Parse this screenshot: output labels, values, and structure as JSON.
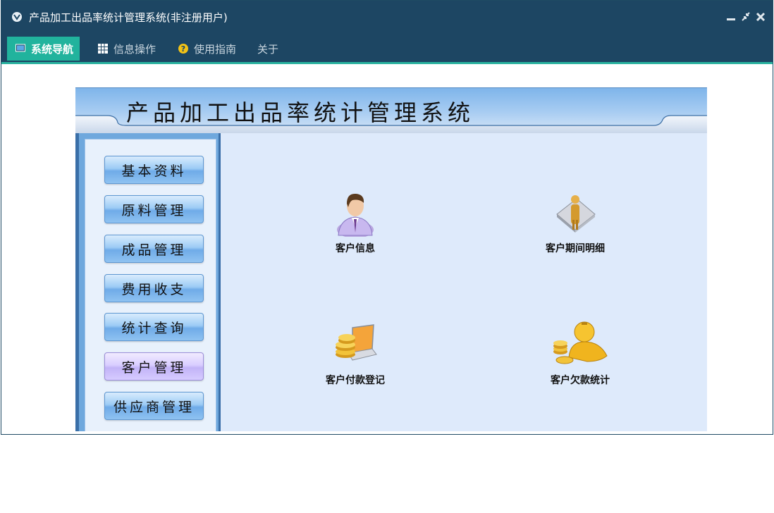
{
  "window": {
    "title": "产品加工出品率统计管理系统(非注册用户)",
    "controls": [
      "minimize-icon",
      "restore-icon",
      "close-icon"
    ]
  },
  "menu": {
    "items": [
      {
        "label": "系统导航",
        "icon": "monitor-icon",
        "active": true
      },
      {
        "label": "信息操作",
        "icon": "grid-icon",
        "active": false
      },
      {
        "label": "使用指南",
        "icon": "help-icon",
        "active": false
      },
      {
        "label": "关于",
        "icon": "",
        "active": false
      }
    ]
  },
  "banner": {
    "title": "产品加工出品率统计管理系统"
  },
  "sidebar": {
    "items": [
      {
        "label": "基本资料"
      },
      {
        "label": "原料管理"
      },
      {
        "label": "成品管理"
      },
      {
        "label": "费用收支"
      },
      {
        "label": "统计查询"
      },
      {
        "label": "客户管理",
        "selected": true
      },
      {
        "label": "供应商管理"
      }
    ]
  },
  "main": {
    "tiles": [
      {
        "label": "客户信息",
        "icon": "customer-person-icon"
      },
      {
        "label": "客户期间明细",
        "icon": "customer-detail-icon"
      },
      {
        "label": "客户付款登记",
        "icon": "payment-laptop-coins-icon"
      },
      {
        "label": "客户欠款统计",
        "icon": "debt-gold-person-icon"
      }
    ]
  },
  "colors": {
    "titlebar": "#1d4663",
    "menu_active": "#21b39d",
    "panel_bg": "#deeafb",
    "button_blue": "#6fabe8",
    "button_selected": "#c2b3f7"
  }
}
